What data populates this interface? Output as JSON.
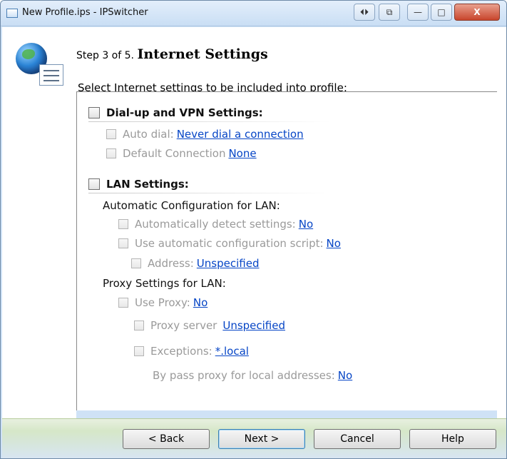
{
  "window": {
    "title": "New Profile.ips - IPSwitcher",
    "controls": {
      "left_btn1": "⏴⏵",
      "left_btn2": "⧉",
      "minimize": "—",
      "maximize": "□",
      "close": "X"
    }
  },
  "header": {
    "step_prefix": "Step 3 of 5.",
    "title": "Internet Settings",
    "description": "Select Internet settings to be included into profile:"
  },
  "dialup": {
    "title": "Dial-up and VPN Settings:",
    "auto_dial_label": "Auto dial:",
    "auto_dial_value": "Never dial a connection",
    "default_conn_label": "Default Connection",
    "default_conn_value": "None"
  },
  "lan": {
    "title": "LAN Settings:",
    "auto_config_heading": "Automatic Configuration for LAN:",
    "auto_detect_label": "Automatically detect settings:",
    "auto_detect_value": "No",
    "use_script_label": "Use automatic configuration script:",
    "use_script_value": "No",
    "address_label": "Address:",
    "address_value": "Unspecified",
    "proxy_heading": "Proxy Settings for LAN:",
    "use_proxy_label": "Use Proxy:",
    "use_proxy_value": "No",
    "proxy_server_label": "Proxy server",
    "proxy_server_value": "Unspecified",
    "exceptions_label": "Exceptions:",
    "exceptions_value": "*.local",
    "bypass_label": "By pass proxy for local addresses:",
    "bypass_value": "No"
  },
  "footer": {
    "back": "< Back",
    "next": "Next >",
    "cancel": "Cancel",
    "help": "Help"
  }
}
